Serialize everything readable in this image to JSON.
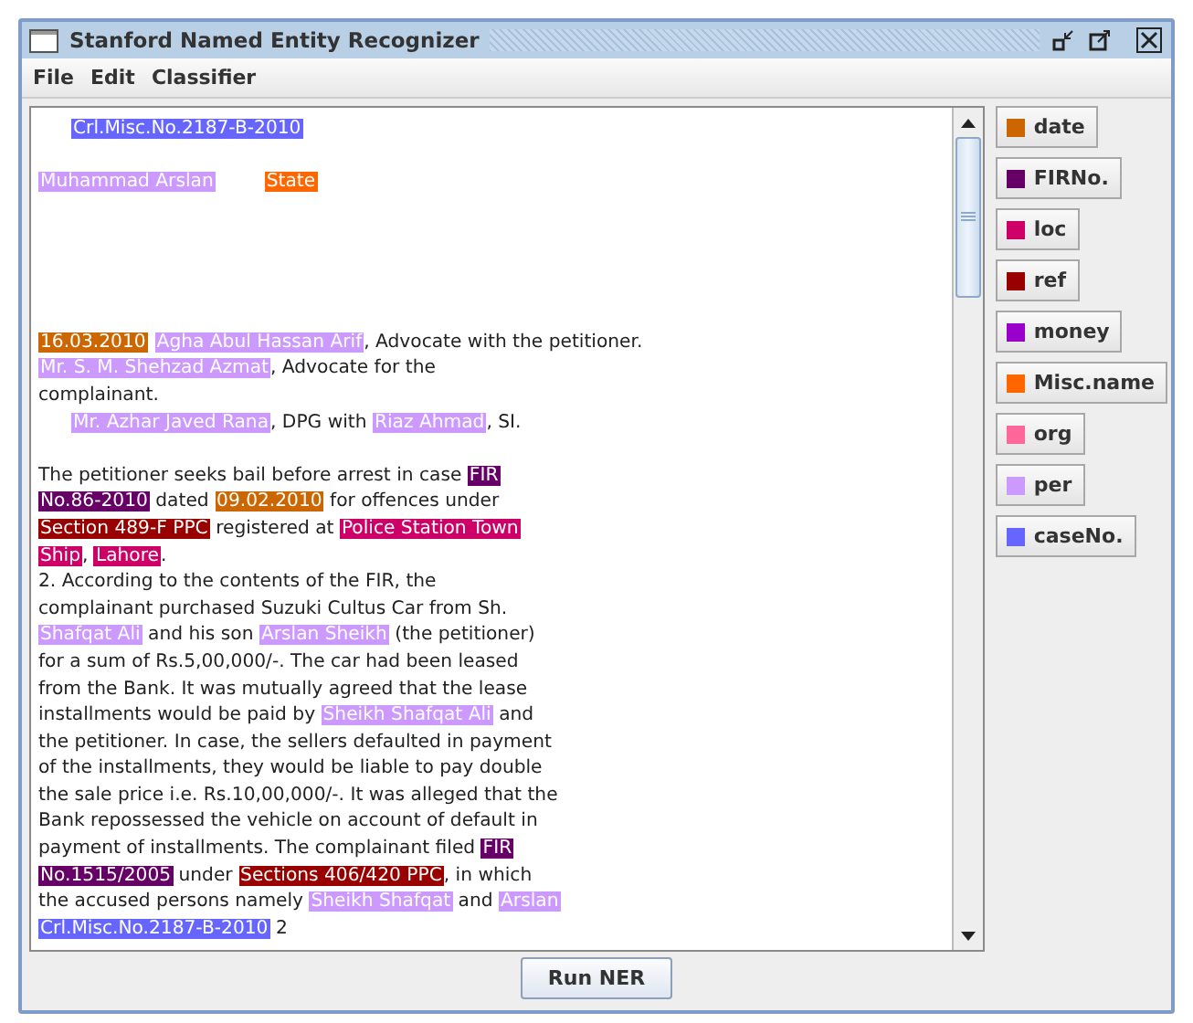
{
  "window": {
    "title": "Stanford Named Entity Recognizer"
  },
  "menu": [
    "File",
    "Edit",
    "Classifier"
  ],
  "document": [
    {
      "kind": "caption",
      "lines": [
        {
          "segments": [
            {
              "text": "Crl.Misc.No.2187-B-2010",
              "color": "#6666ff"
            }
          ]
        }
      ]
    },
    {
      "kind": "parties",
      "lines": [
        {
          "segments": [
            {
              "text": "Muhammad Arslan",
              "color": "#cc99ff"
            },
            {
              "text": "State",
              "color": "#ff6600"
            }
          ]
        }
      ]
    },
    {
      "kind": "lines",
      "lines": [
        {
          "segments": [
            {
              "text": "16.03.2010",
              "color": "#cc6600"
            },
            {
              "text": "Agha Abul Hassan Arif",
              "color": "#cc99ff"
            },
            {
              "text": ", Advocate with the petitioner."
            }
          ]
        },
        {
          "segments": [
            {
              "text": "Mr. S. M. Shehzad Azmat",
              "color": "#cc99ff"
            },
            {
              "text": ", Advocate for the"
            }
          ]
        },
        {
          "segments": [
            {
              "text": "complainant."
            }
          ]
        }
      ]
    },
    {
      "kind": "indented",
      "lines": [
        {
          "segments": [
            {
              "text": "Mr. Azhar Javed Rana",
              "color": "#cc99ff"
            },
            {
              "text": ", DPG with "
            },
            {
              "text": "Riaz Ahmad",
              "color": "#cc99ff"
            },
            {
              "text": ", SI."
            }
          ]
        }
      ]
    },
    {
      "kind": "body",
      "lines": [
        {
          "segments": [
            {
              "text": "The petitioner seeks bail before arrest in case "
            },
            {
              "text": "FIR",
              "color": "#660066"
            }
          ]
        },
        {
          "segments": [
            {
              "text": "No.86-2010",
              "color": "#660066"
            },
            {
              "text": " dated "
            },
            {
              "text": "09.02.2010",
              "color": "#cc6600"
            },
            {
              "text": " for offences under"
            }
          ]
        },
        {
          "segments": [
            {
              "text": "Section 489-F PPC",
              "color": "#990000"
            },
            {
              "text": " registered at "
            },
            {
              "text": "Police Station Town",
              "color": "#cc0066"
            }
          ]
        },
        {
          "segments": [
            {
              "text": "Ship",
              "color": "#cc0066"
            },
            {
              "text": ", "
            },
            {
              "text": "Lahore",
              "color": "#cc0066"
            },
            {
              "text": "."
            }
          ]
        },
        {
          "segments": [
            {
              "text": "2. According to the contents of the FIR, the"
            }
          ]
        },
        {
          "segments": [
            {
              "text": "complainant purchased Suzuki Cultus Car from Sh."
            }
          ]
        },
        {
          "segments": [
            {
              "text": "Shafqat Ali",
              "color": "#cc99ff"
            },
            {
              "text": " and his son "
            },
            {
              "text": "Arslan Sheikh",
              "color": "#cc99ff"
            },
            {
              "text": " (the petitioner)"
            }
          ]
        },
        {
          "segments": [
            {
              "text": "for a sum of Rs.5,00,000/-. The car had been leased"
            }
          ]
        },
        {
          "segments": [
            {
              "text": "from the Bank. It was mutually agreed that the lease"
            }
          ]
        },
        {
          "segments": [
            {
              "text": "installments would be paid by "
            },
            {
              "text": "Sheikh Shafqat Ali",
              "color": "#cc99ff"
            },
            {
              "text": " and"
            }
          ]
        },
        {
          "segments": [
            {
              "text": "the petitioner. In case, the sellers defaulted in payment"
            }
          ]
        },
        {
          "segments": [
            {
              "text": "of the installments, they would be liable to pay double"
            }
          ]
        },
        {
          "segments": [
            {
              "text": "the sale price i.e. Rs.10,00,000/-. It was alleged that the"
            }
          ]
        },
        {
          "segments": [
            {
              "text": "Bank repossessed the vehicle on account of default in"
            }
          ]
        },
        {
          "segments": [
            {
              "text": "payment of installments. The complainant filed "
            },
            {
              "text": "FIR",
              "color": "#660066"
            }
          ]
        },
        {
          "segments": [
            {
              "text": "No.1515/2005",
              "color": "#660066"
            },
            {
              "text": " under "
            },
            {
              "text": "Sections 406/420 PPC",
              "color": "#990000"
            },
            {
              "text": ", in which"
            }
          ]
        },
        {
          "segments": [
            {
              "text": "the accused persons namely "
            },
            {
              "text": "Sheikh Shafqat",
              "color": "#cc99ff"
            },
            {
              "text": " and "
            },
            {
              "text": "Arslan",
              "color": "#cc99ff"
            }
          ]
        },
        {
          "segments": [
            {
              "text": "Crl.Misc.No.2187-B-2010",
              "color": "#6666ff"
            },
            {
              "text": " 2"
            }
          ]
        }
      ]
    }
  ],
  "legend": [
    {
      "label": "date",
      "color": "#cc6600"
    },
    {
      "label": "FIRNo.",
      "color": "#660066"
    },
    {
      "label": "loc",
      "color": "#cc0066"
    },
    {
      "label": "ref",
      "color": "#990000"
    },
    {
      "label": "money",
      "color": "#9900cc"
    },
    {
      "label": "Misc.name",
      "color": "#ff6600"
    },
    {
      "label": "org",
      "color": "#ff6699"
    },
    {
      "label": "per",
      "color": "#cc99ff"
    },
    {
      "label": "caseNo.",
      "color": "#6666ff"
    }
  ],
  "run_button": "Run NER"
}
